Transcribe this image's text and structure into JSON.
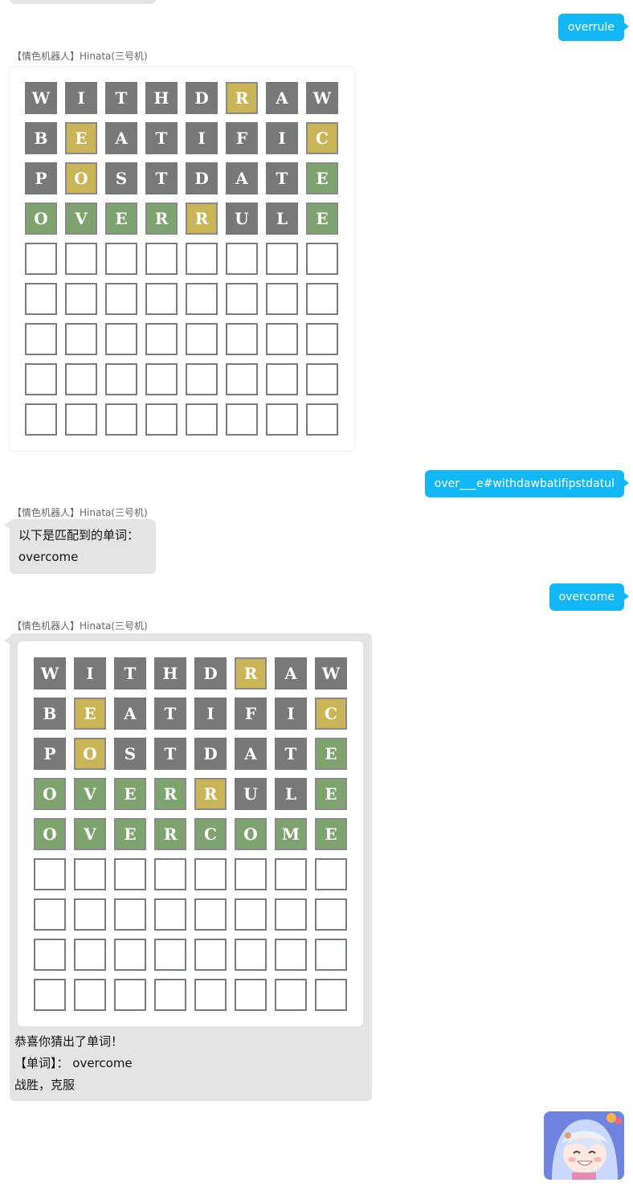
{
  "messages": {
    "overrule": {
      "text": "overrule"
    },
    "query": {
      "text": "over___e#withdawbatifipstdatul"
    },
    "overcome": {
      "text": "overcome"
    }
  },
  "sender": {
    "name": "【情色机器人】Hinata(三号机)"
  },
  "match_reply": {
    "line1": "以下是匹配到的单词：",
    "line2": "overcome"
  },
  "result": {
    "line1": "恭喜你猜出了单词！",
    "line2": "【单词】：  overcome",
    "line3": "战胜，克服"
  },
  "board1": {
    "rows": [
      [
        [
          "W",
          "gray"
        ],
        [
          "I",
          "gray"
        ],
        [
          "T",
          "gray"
        ],
        [
          "H",
          "gray"
        ],
        [
          "D",
          "gray"
        ],
        [
          "R",
          "yellow"
        ],
        [
          "A",
          "gray"
        ],
        [
          "W",
          "gray"
        ]
      ],
      [
        [
          "B",
          "gray"
        ],
        [
          "E",
          "yellow"
        ],
        [
          "A",
          "gray"
        ],
        [
          "T",
          "gray"
        ],
        [
          "I",
          "gray"
        ],
        [
          "F",
          "gray"
        ],
        [
          "I",
          "gray"
        ],
        [
          "C",
          "yellow"
        ]
      ],
      [
        [
          "P",
          "gray"
        ],
        [
          "O",
          "yellow"
        ],
        [
          "S",
          "gray"
        ],
        [
          "T",
          "gray"
        ],
        [
          "D",
          "gray"
        ],
        [
          "A",
          "gray"
        ],
        [
          "T",
          "gray"
        ],
        [
          "E",
          "green"
        ]
      ],
      [
        [
          "O",
          "green"
        ],
        [
          "V",
          "green"
        ],
        [
          "E",
          "green"
        ],
        [
          "R",
          "green"
        ],
        [
          "R",
          "yellow"
        ],
        [
          "U",
          "gray"
        ],
        [
          "L",
          "gray"
        ],
        [
          "E",
          "green"
        ]
      ]
    ],
    "total_rows": 9
  },
  "board2": {
    "rows": [
      [
        [
          "W",
          "gray"
        ],
        [
          "I",
          "gray"
        ],
        [
          "T",
          "gray"
        ],
        [
          "H",
          "gray"
        ],
        [
          "D",
          "gray"
        ],
        [
          "R",
          "yellow"
        ],
        [
          "A",
          "gray"
        ],
        [
          "W",
          "gray"
        ]
      ],
      [
        [
          "B",
          "gray"
        ],
        [
          "E",
          "yellow"
        ],
        [
          "A",
          "gray"
        ],
        [
          "T",
          "gray"
        ],
        [
          "I",
          "gray"
        ],
        [
          "F",
          "gray"
        ],
        [
          "I",
          "gray"
        ],
        [
          "C",
          "yellow"
        ]
      ],
      [
        [
          "P",
          "gray"
        ],
        [
          "O",
          "yellow"
        ],
        [
          "S",
          "gray"
        ],
        [
          "T",
          "gray"
        ],
        [
          "D",
          "gray"
        ],
        [
          "A",
          "gray"
        ],
        [
          "T",
          "gray"
        ],
        [
          "E",
          "green"
        ]
      ],
      [
        [
          "O",
          "green"
        ],
        [
          "V",
          "green"
        ],
        [
          "E",
          "green"
        ],
        [
          "R",
          "green"
        ],
        [
          "R",
          "yellow"
        ],
        [
          "U",
          "gray"
        ],
        [
          "L",
          "gray"
        ],
        [
          "E",
          "green"
        ]
      ],
      [
        [
          "O",
          "green"
        ],
        [
          "V",
          "green"
        ],
        [
          "E",
          "green"
        ],
        [
          "R",
          "green"
        ],
        [
          "C",
          "green"
        ],
        [
          "O",
          "green"
        ],
        [
          "M",
          "green"
        ],
        [
          "E",
          "green"
        ]
      ]
    ],
    "total_rows": 9
  },
  "colors": {
    "outgoing_bubble": "#12b7f5",
    "incoming_bubble": "#e4e4e4",
    "tile_gray": "#787878",
    "tile_yellow": "#c9b458",
    "tile_green": "#7fa36e"
  }
}
